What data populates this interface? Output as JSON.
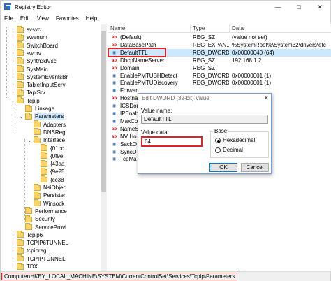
{
  "window": {
    "title": "Registry Editor"
  },
  "menu": [
    "File",
    "Edit",
    "View",
    "Favorites",
    "Help"
  ],
  "tree": {
    "items": [
      {
        "label": "svsvc",
        "level": 0,
        "expander": "›"
      },
      {
        "label": "swenum",
        "level": 0,
        "expander": "›"
      },
      {
        "label": "SwitchBoard",
        "level": 0,
        "expander": "›"
      },
      {
        "label": "swprv",
        "level": 0,
        "expander": "›"
      },
      {
        "label": "Synth3dVsc",
        "level": 0,
        "expander": "›"
      },
      {
        "label": "SysMain",
        "level": 0,
        "expander": "›"
      },
      {
        "label": "SystemEventsBr",
        "level": 0,
        "expander": "›"
      },
      {
        "label": "TabletInputServi",
        "level": 0,
        "expander": "›"
      },
      {
        "label": "TapiSrv",
        "level": 0,
        "expander": "›"
      },
      {
        "label": "Tcpip",
        "level": 0,
        "expander": "⌄"
      },
      {
        "label": "Linkage",
        "level": 1,
        "expander": ""
      },
      {
        "label": "Parameters",
        "level": 1,
        "expander": "⌄",
        "selected": true
      },
      {
        "label": "Adapters",
        "level": 2,
        "expander": ""
      },
      {
        "label": "DNSRegi",
        "level": 2,
        "expander": ""
      },
      {
        "label": "Interface",
        "level": 2,
        "expander": "⌄"
      },
      {
        "label": "{01cc",
        "level": 3,
        "expander": ""
      },
      {
        "label": "{0f9e",
        "level": 3,
        "expander": ""
      },
      {
        "label": "{43aa",
        "level": 3,
        "expander": ""
      },
      {
        "label": "{9e25",
        "level": 3,
        "expander": ""
      },
      {
        "label": "{cc38",
        "level": 3,
        "expander": ""
      },
      {
        "label": "NsiObjec",
        "level": 2,
        "expander": ""
      },
      {
        "label": "Persisten",
        "level": 2,
        "expander": ""
      },
      {
        "label": "Winsock",
        "level": 2,
        "expander": ""
      },
      {
        "label": "Performance",
        "level": 1,
        "expander": ""
      },
      {
        "label": "Security",
        "level": 1,
        "expander": ""
      },
      {
        "label": "ServiceProvi",
        "level": 1,
        "expander": ""
      },
      {
        "label": "Tcpip6",
        "level": 0,
        "expander": "›"
      },
      {
        "label": "TCPIP6TUNNEL",
        "level": 0,
        "expander": "›"
      },
      {
        "label": "tcpipreg",
        "level": 0,
        "expander": "›"
      },
      {
        "label": "TCPIPTUNNEL",
        "level": 0,
        "expander": "›"
      },
      {
        "label": "TDX",
        "level": 0,
        "expander": "›"
      }
    ]
  },
  "list": {
    "headers": {
      "name": "Name",
      "type": "Type",
      "data": "Data"
    },
    "rows": [
      {
        "icon": "ab",
        "name": "(Default)",
        "type": "REG_SZ",
        "data": "(value not set)"
      },
      {
        "icon": "ab",
        "name": "DataBasePath",
        "type": "REG_EXPAN...",
        "data": "%SystemRoot%\\System32\\drivers\\etc"
      },
      {
        "icon": "bin",
        "name": "DefaultTTL",
        "type": "REG_DWORD",
        "data": "0x00000040 (64)",
        "selected": true
      },
      {
        "icon": "ab",
        "name": "DhcpNameServer",
        "type": "REG_SZ",
        "data": "192.168.1.2"
      },
      {
        "icon": "ab",
        "name": "Domain",
        "type": "REG_SZ",
        "data": ""
      },
      {
        "icon": "bin",
        "name": "EnablePMTUBHDetect",
        "type": "REG_DWORD",
        "data": "0x00000001 (1)"
      },
      {
        "icon": "bin",
        "name": "EnablePMTUDiscovery",
        "type": "REG_DWORD",
        "data": "0x00000001 (1)"
      },
      {
        "icon": "bin",
        "name": "Forwar",
        "type": "",
        "data": ""
      },
      {
        "icon": "ab",
        "name": "Hostna",
        "type": "",
        "data": ""
      },
      {
        "icon": "bin",
        "name": "ICSDom",
        "type": "",
        "data": ""
      },
      {
        "icon": "bin",
        "name": "IPEnab",
        "type": "",
        "data": ""
      },
      {
        "icon": "bin",
        "name": "MaxCo",
        "type": "",
        "data": ""
      },
      {
        "icon": "ab",
        "name": "NameS",
        "type": "",
        "data": ""
      },
      {
        "icon": "ab",
        "name": "NV Ho",
        "type": "",
        "data": ""
      },
      {
        "icon": "bin",
        "name": "SackO",
        "type": "",
        "data": ""
      },
      {
        "icon": "bin",
        "name": "SyncD",
        "type": "",
        "data": ""
      },
      {
        "icon": "bin",
        "name": "TcpMa",
        "type": "",
        "data": ""
      }
    ]
  },
  "dialog": {
    "title": "Edit DWORD (32-bit) Value",
    "value_name_label": "Value name:",
    "value_name": "DefaultTTL",
    "value_data_label": "Value data:",
    "value_data": "64",
    "base_label": "Base",
    "hex_label": "Hexadecimal",
    "dec_label": "Decimal",
    "base_selected": "hexadecimal",
    "ok_label": "OK",
    "cancel_label": "Cancel"
  },
  "status": {
    "path": "Computer\\HKEY_LOCAL_MACHINE\\SYSTEM\\CurrentControlSet\\Services\\Tcpip\\Parameters"
  },
  "colors": {
    "highlight": "#e02424",
    "selection": "#cce8ff",
    "accent": "#0078d7"
  }
}
